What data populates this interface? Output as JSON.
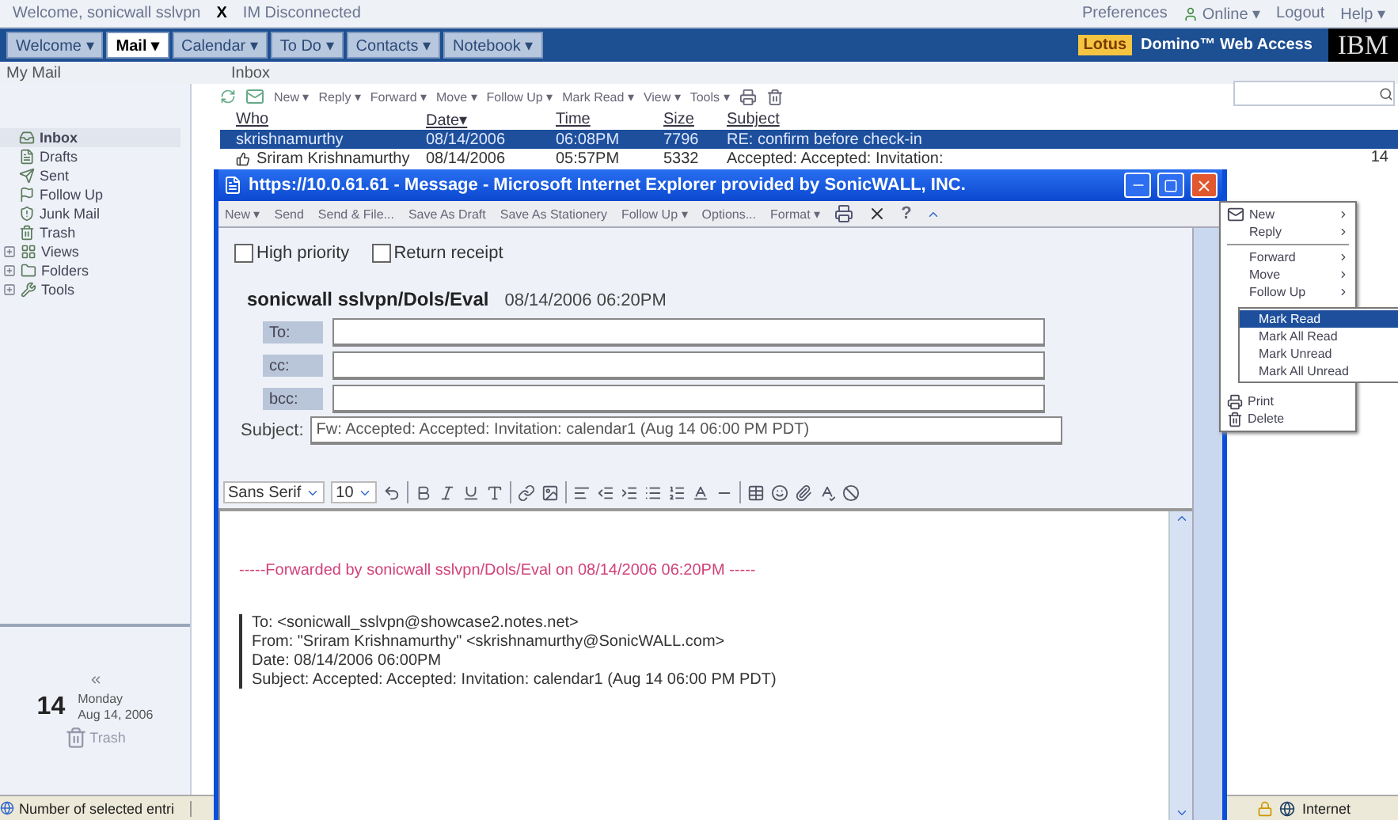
{
  "top_bar": {
    "welcome": "Welcome, sonicwall sslvpn",
    "close": "X",
    "im_status": "IM Disconnected",
    "links": [
      {
        "label": "Preferences",
        "kind": "plain"
      },
      {
        "label": "Online ▾",
        "kind": "status"
      },
      {
        "label": "Logout",
        "kind": "plain"
      },
      {
        "label": "Help ▾",
        "kind": "plain"
      }
    ]
  },
  "nav": {
    "tabs": [
      {
        "label": "Welcome ▾",
        "selected": false
      },
      {
        "label": "Mail ▾",
        "selected": true
      },
      {
        "label": "Calendar ▾",
        "selected": false
      },
      {
        "label": "To Do ▾",
        "selected": false
      },
      {
        "label": "Contacts ▾",
        "selected": false
      },
      {
        "label": "Notebook ▾",
        "selected": false
      }
    ],
    "brand": {
      "badge": "Lotus",
      "product": "Domino™ Web Access",
      "logo": "IBM"
    }
  },
  "sub_header": {
    "section": "My Mail",
    "folder": "Inbox"
  },
  "sidebar": {
    "items": [
      {
        "label": "Inbox",
        "kind": "inbox",
        "selected": true
      },
      {
        "label": "Drafts",
        "kind": "drafts",
        "selected": false
      },
      {
        "label": "Sent",
        "kind": "sent",
        "selected": false
      },
      {
        "label": "Follow Up",
        "kind": "follow",
        "selected": false
      },
      {
        "label": "Junk Mail",
        "kind": "junk",
        "selected": false
      },
      {
        "label": "Trash",
        "kind": "trash",
        "selected": false
      },
      {
        "label": "Views",
        "kind": "views",
        "selected": false,
        "expanded": false
      },
      {
        "label": "Folders",
        "kind": "folders",
        "selected": false,
        "expanded": false
      },
      {
        "label": "Tools",
        "kind": "tools",
        "selected": false,
        "expanded": false
      }
    ]
  },
  "mini_calendar": {
    "day": "14",
    "weekday": "Monday",
    "date": "Aug 14, 2006",
    "trash": "Trash"
  },
  "toolbar": {
    "actions": [
      "New ▾",
      "Reply ▾",
      "Forward ▾",
      "Move ▾",
      "Follow Up ▾",
      "Mark Read ▾",
      "View ▾",
      "Tools ▾"
    ]
  },
  "table": {
    "columns": [
      "Who",
      "Date▾",
      "Time",
      "Size",
      "Subject"
    ],
    "rows": [
      {
        "kind": "plain",
        "selected": true,
        "cells": [
          "skrishnamurthy",
          "08/14/2006",
          "06:08PM",
          "7796",
          "RE: confirm before check-in"
        ]
      },
      {
        "kind": "accepted",
        "selected": false,
        "cells": [
          "Sriram Krishnamurthy",
          "08/14/2006",
          "05:57PM",
          "5332",
          "Accepted: Accepted: Invitation:"
        ],
        "tail": "14"
      }
    ]
  },
  "context_menu": {
    "items": [
      {
        "label": "New",
        "kind": "new"
      },
      {
        "label": "Reply",
        "kind": "submenu"
      },
      {
        "kind": "separator"
      },
      {
        "label": "Forward",
        "kind": "submenu"
      },
      {
        "label": "Move",
        "kind": "submenu"
      },
      {
        "label": "Follow Up",
        "kind": "submenu"
      },
      {
        "kind": "hidden"
      },
      {
        "label": "Print",
        "kind": "print"
      },
      {
        "label": "Delete",
        "kind": "delete"
      }
    ],
    "submenu": [
      {
        "label": "Mark Read",
        "selected": true
      },
      {
        "label": "Mark All Read",
        "selected": false
      },
      {
        "label": "Mark Unread",
        "selected": false
      },
      {
        "label": "Mark All Unread",
        "selected": false
      }
    ]
  },
  "popup": {
    "title": "https://10.0.61.61 - Message - Microsoft Internet Explorer provided by SonicWALL, INC.",
    "toolbar": [
      "New ▾",
      "Send",
      "Send & File...",
      "Save As Draft",
      "Save As Stationery",
      "Follow Up ▾",
      "Options...",
      "Format ▾"
    ],
    "help": "?",
    "options": [
      {
        "label": "High priority",
        "checked": false
      },
      {
        "label": "Return receipt",
        "checked": false
      }
    ],
    "from": {
      "name": "sonicwall sslvpn/Dols/Eval",
      "date": "08/14/2006 06:20PM"
    },
    "address_fields": [
      "To:",
      "cc:",
      "bcc:"
    ],
    "subject": {
      "label": "Subject:",
      "value": "Fw: Accepted: Accepted: Invitation: calendar1 (Aug 14 06:00 PM PDT)"
    },
    "editor": {
      "font": "Sans Serif",
      "size": "10",
      "forward_line": "-----Forwarded by sonicwall sslvpn/Dols/Eval on 08/14/2006 06:20PM -----",
      "quote": [
        "To: <sonicwall_sslvpn@showcase2.notes.net>",
        "From: \"Sriram Krishnamurthy\" <skrishnamurthy@SonicWALL.com>",
        "Date: 08/14/2006 06:00PM",
        "Subject: Accepted: Accepted: Invitation: calendar1 (Aug 14 06:00 PM PDT)"
      ]
    }
  },
  "status_bar": {
    "text": "Number of selected entri",
    "zone": "Internet"
  }
}
